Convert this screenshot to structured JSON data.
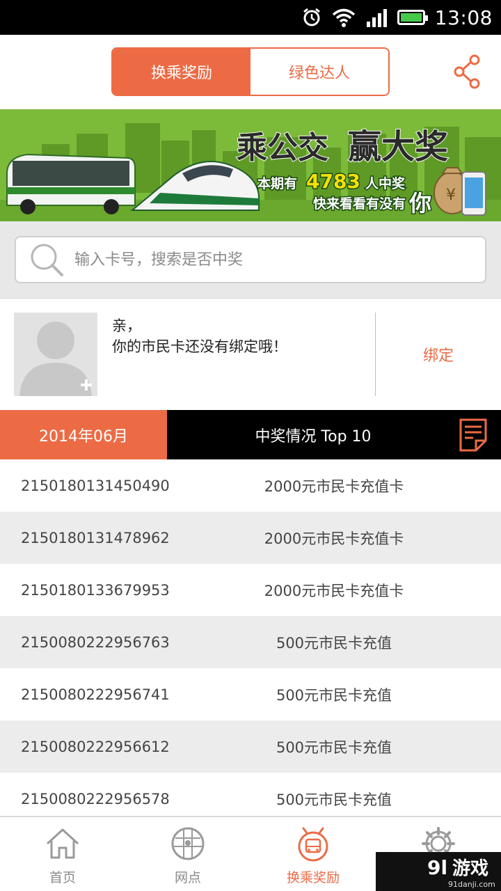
{
  "status_bar": {
    "time": "13:08"
  },
  "header": {
    "tabs": [
      {
        "label": "换乘奖励",
        "active": true
      },
      {
        "label": "绿色达人",
        "active": false
      }
    ],
    "accent_color": "#ec6b45"
  },
  "banner": {
    "headline_left": "乘公交",
    "headline_right": "赢大奖",
    "line1_prefix": "本期有",
    "winner_count": "4783",
    "line1_suffix": "人中奖",
    "line2": "快来看看有没有",
    "line2_big": "你",
    "money_symbol": "¥"
  },
  "search": {
    "placeholder": "输入卡号，搜索是否中奖"
  },
  "user": {
    "greeting": "亲，",
    "message": "你的市民卡还没有绑定哦！",
    "bind_label": "绑定"
  },
  "list_header": {
    "month": "2014年06月",
    "title": "中奖情况 Top 10"
  },
  "winners": [
    {
      "card": "2150180131450490",
      "prize": "2000元市民卡充值卡"
    },
    {
      "card": "2150180131478962",
      "prize": "2000元市民卡充值卡"
    },
    {
      "card": "2150180133679953",
      "prize": "2000元市民卡充值卡"
    },
    {
      "card": "2150080222956763",
      "prize": "500元市民卡充值"
    },
    {
      "card": "2150080222956741",
      "prize": "500元市民卡充值"
    },
    {
      "card": "2150080222956612",
      "prize": "500元市民卡充值"
    },
    {
      "card": "2150080222956578",
      "prize": "500元市民卡充值"
    }
  ],
  "tab_bar": [
    {
      "label": "首页",
      "icon": "home-icon",
      "active": false
    },
    {
      "label": "网点",
      "icon": "map-grid-icon",
      "active": false
    },
    {
      "label": "换乘奖励",
      "icon": "bus-reward-icon",
      "active": true
    },
    {
      "label": "",
      "icon": "gear-icon",
      "active": false
    }
  ],
  "watermark": {
    "logo": "9l",
    "text": "游戏",
    "url": "91danji.com"
  }
}
